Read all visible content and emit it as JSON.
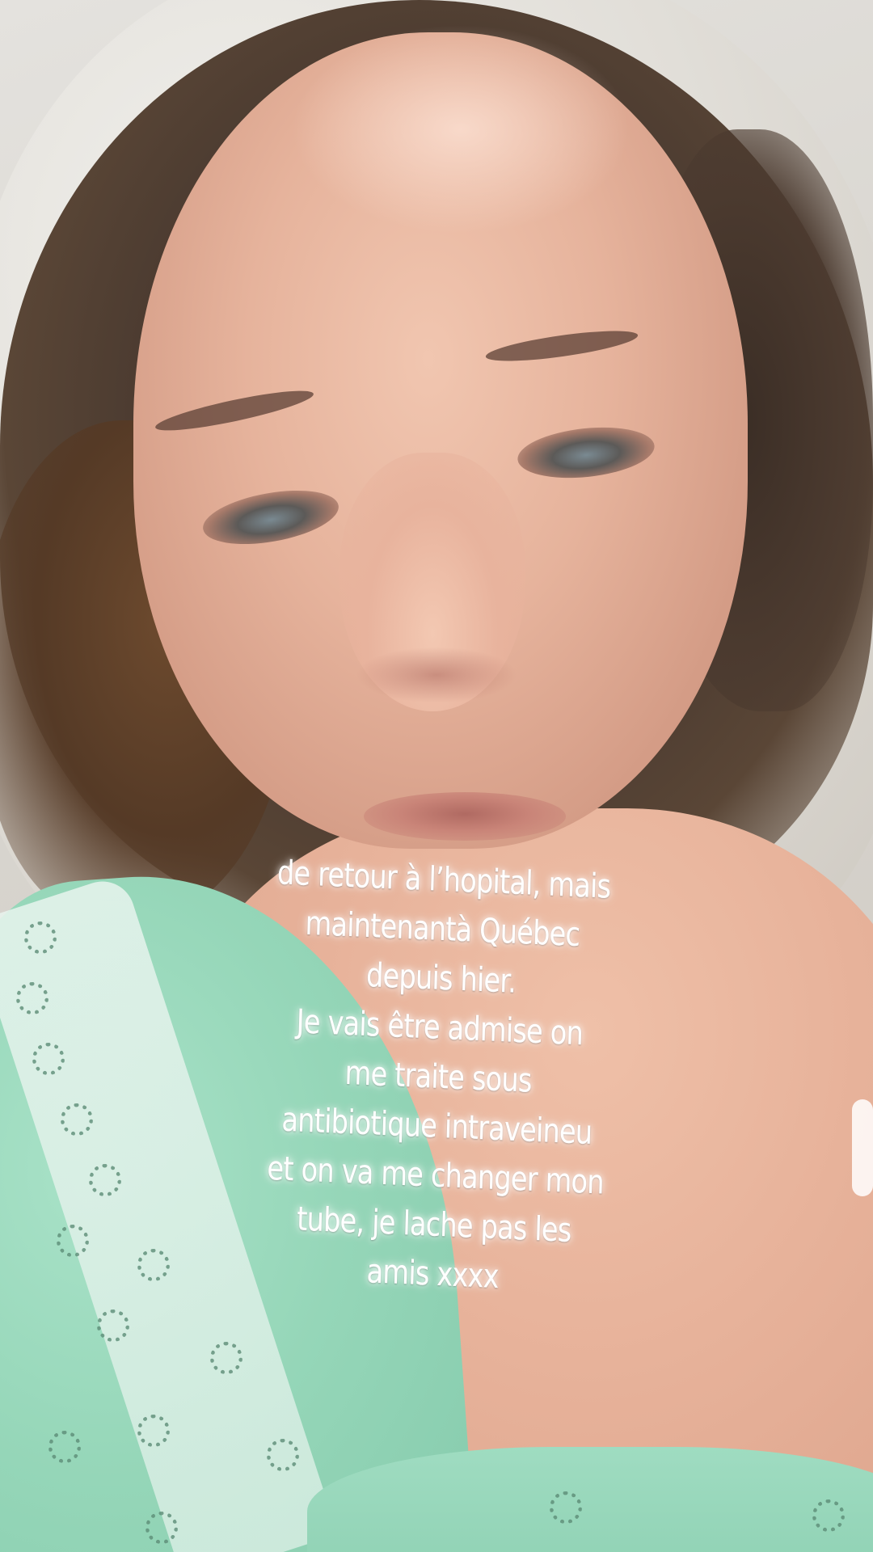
{
  "story": {
    "caption_lines": [
      "de retour à l’hopital, mais",
      "maintenantà Québec",
      "depuis hier.",
      "Je vais être admise on",
      "me traite sous",
      "antibiotique intraveineu",
      "et on va me changer mon",
      "tube, je lache pas les",
      "amis xxxx"
    ],
    "text_color": "#ffffff"
  },
  "colors": {
    "gown": "#95d6b8",
    "skin": "#e6b39c",
    "hair": "#4a3a30",
    "pillow": "#e1ded8"
  }
}
